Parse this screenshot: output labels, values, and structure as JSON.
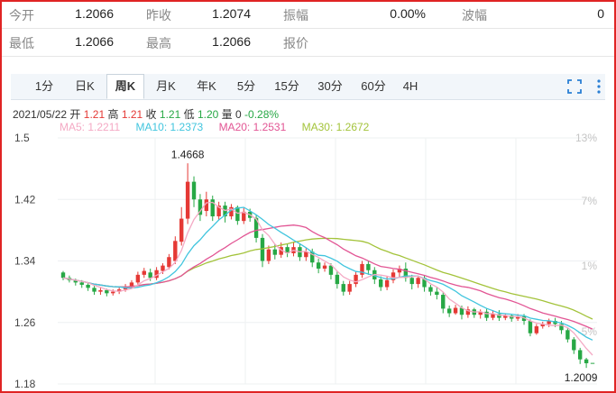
{
  "quote": {
    "row1": [
      {
        "label": "今开",
        "value": "1.2066"
      },
      {
        "label": "昨收",
        "value": "1.2074"
      },
      {
        "label": "振幅",
        "value": "0.00%"
      },
      {
        "label": "波幅",
        "value": "0"
      }
    ],
    "row2": [
      {
        "label": "最低",
        "value": "1.2066"
      },
      {
        "label": "最高",
        "value": "1.2066"
      },
      {
        "label": "报价",
        "value": ""
      }
    ]
  },
  "tabs": [
    {
      "label": "1分",
      "active": false
    },
    {
      "label": "日K",
      "active": false
    },
    {
      "label": "周K",
      "active": true
    },
    {
      "label": "月K",
      "active": false
    },
    {
      "label": "年K",
      "active": false
    },
    {
      "label": "5分",
      "active": false
    },
    {
      "label": "15分",
      "active": false
    },
    {
      "label": "30分",
      "active": false
    },
    {
      "label": "60分",
      "active": false
    },
    {
      "label": "4H",
      "active": false
    }
  ],
  "toolbar_icons": [
    "fullscreen-icon",
    "more-vertical-icon"
  ],
  "bar_info": {
    "date": "2021/05/22",
    "open_label": "开",
    "open": "1.21",
    "high_label": "高",
    "high": "1.21",
    "close_label": "收",
    "close": "1.21",
    "low_label": "低",
    "low": "1.20",
    "volume_label": "量",
    "volume": "0",
    "change": "-0.28%"
  },
  "ma_legend": [
    {
      "label": "MA5: 1.2211",
      "color": "#f4a9c4"
    },
    {
      "label": "MA10: 1.2373",
      "color": "#41c5de"
    },
    {
      "label": "MA20: 1.2531",
      "color": "#e25594"
    },
    {
      "label": "MA30: 1.2672",
      "color": "#a3c33a"
    }
  ],
  "colors": {
    "up": "#e53935",
    "down": "#27a845",
    "frame": "#e02424"
  },
  "chart_data": {
    "type": "candlestick",
    "y_ticks": [
      "1.5",
      "1.42",
      "1.34",
      "1.26",
      "1.18"
    ],
    "y_tick_values": [
      1.5,
      1.42,
      1.34,
      1.26,
      1.18
    ],
    "pct_ticks": [
      "13%",
      "7%",
      "1%",
      "-5%"
    ],
    "ylim": [
      1.18,
      1.5
    ],
    "annotations": {
      "max_label": "1.4668",
      "max_value": 1.4668,
      "min_label": "1.2009",
      "min_value": 1.2009
    },
    "candles": [
      [
        1.325,
        1.318,
        1.327,
        1.315
      ],
      [
        1.318,
        1.315,
        1.321,
        1.312
      ],
      [
        1.315,
        1.312,
        1.317,
        1.308
      ],
      [
        1.312,
        1.309,
        1.315,
        1.305
      ],
      [
        1.309,
        1.305,
        1.312,
        1.301
      ],
      [
        1.305,
        1.3,
        1.308,
        1.296
      ],
      [
        1.3,
        1.302,
        1.305,
        1.296
      ],
      [
        1.302,
        1.298,
        1.304,
        1.294
      ],
      [
        1.298,
        1.3,
        1.303,
        1.295
      ],
      [
        1.3,
        1.303,
        1.306,
        1.297
      ],
      [
        1.303,
        1.307,
        1.31,
        1.3
      ],
      [
        1.307,
        1.312,
        1.315,
        1.304
      ],
      [
        1.312,
        1.322,
        1.326,
        1.309
      ],
      [
        1.322,
        1.327,
        1.331,
        1.318
      ],
      [
        1.325,
        1.318,
        1.33,
        1.314
      ],
      [
        1.318,
        1.328,
        1.332,
        1.315
      ],
      [
        1.327,
        1.334,
        1.337,
        1.323
      ],
      [
        1.332,
        1.345,
        1.349,
        1.329
      ],
      [
        1.34,
        1.366,
        1.372,
        1.336
      ],
      [
        1.365,
        1.395,
        1.41,
        1.36
      ],
      [
        1.395,
        1.443,
        1.467,
        1.388
      ],
      [
        1.443,
        1.42,
        1.45,
        1.41
      ],
      [
        1.42,
        1.4,
        1.427,
        1.392
      ],
      [
        1.405,
        1.42,
        1.43,
        1.398
      ],
      [
        1.42,
        1.398,
        1.425,
        1.392
      ],
      [
        1.398,
        1.412,
        1.417,
        1.393
      ],
      [
        1.412,
        1.398,
        1.417,
        1.39
      ],
      [
        1.398,
        1.41,
        1.414,
        1.394
      ],
      [
        1.41,
        1.392,
        1.412,
        1.387
      ],
      [
        1.392,
        1.404,
        1.409,
        1.388
      ],
      [
        1.404,
        1.396,
        1.408,
        1.391
      ],
      [
        1.396,
        1.37,
        1.4,
        1.364
      ],
      [
        1.37,
        1.34,
        1.375,
        1.332
      ],
      [
        1.34,
        1.355,
        1.36,
        1.336
      ],
      [
        1.355,
        1.348,
        1.362,
        1.342
      ],
      [
        1.348,
        1.358,
        1.364,
        1.344
      ],
      [
        1.358,
        1.35,
        1.362,
        1.345
      ],
      [
        1.35,
        1.358,
        1.365,
        1.346
      ],
      [
        1.358,
        1.345,
        1.362,
        1.34
      ],
      [
        1.345,
        1.352,
        1.357,
        1.34
      ],
      [
        1.352,
        1.338,
        1.356,
        1.332
      ],
      [
        1.338,
        1.33,
        1.343,
        1.324
      ],
      [
        1.33,
        1.334,
        1.338,
        1.326
      ],
      [
        1.334,
        1.322,
        1.337,
        1.316
      ],
      [
        1.322,
        1.31,
        1.326,
        1.304
      ],
      [
        1.31,
        1.3,
        1.314,
        1.295
      ],
      [
        1.3,
        1.31,
        1.314,
        1.296
      ],
      [
        1.31,
        1.322,
        1.326,
        1.306
      ],
      [
        1.322,
        1.336,
        1.34,
        1.318
      ],
      [
        1.336,
        1.328,
        1.34,
        1.322
      ],
      [
        1.328,
        1.316,
        1.332,
        1.31
      ],
      [
        1.316,
        1.306,
        1.32,
        1.301
      ],
      [
        1.306,
        1.315,
        1.32,
        1.302
      ],
      [
        1.315,
        1.325,
        1.329,
        1.311
      ],
      [
        1.325,
        1.33,
        1.334,
        1.318
      ],
      [
        1.33,
        1.318,
        1.338,
        1.313
      ],
      [
        1.318,
        1.31,
        1.322,
        1.303
      ],
      [
        1.31,
        1.318,
        1.321,
        1.305
      ],
      [
        1.318,
        1.306,
        1.321,
        1.3
      ],
      [
        1.306,
        1.3,
        1.309,
        1.295
      ],
      [
        1.3,
        1.296,
        1.306,
        1.29
      ],
      [
        1.296,
        1.278,
        1.299,
        1.272
      ],
      [
        1.278,
        1.272,
        1.282,
        1.267
      ],
      [
        1.272,
        1.279,
        1.283,
        1.27
      ],
      [
        1.279,
        1.27,
        1.282,
        1.264
      ],
      [
        1.27,
        1.277,
        1.281,
        1.266
      ],
      [
        1.277,
        1.27,
        1.279,
        1.266
      ],
      [
        1.27,
        1.274,
        1.277,
        1.265
      ],
      [
        1.274,
        1.266,
        1.278,
        1.262
      ],
      [
        1.266,
        1.271,
        1.276,
        1.263
      ],
      [
        1.271,
        1.266,
        1.276,
        1.262
      ],
      [
        1.266,
        1.269,
        1.272,
        1.263
      ],
      [
        1.269,
        1.265,
        1.271,
        1.261
      ],
      [
        1.265,
        1.268,
        1.271,
        1.262
      ],
      [
        1.268,
        1.262,
        1.271,
        1.257
      ],
      [
        1.262,
        1.246,
        1.264,
        1.242
      ],
      [
        1.246,
        1.255,
        1.258,
        1.244
      ],
      [
        1.255,
        1.258,
        1.261,
        1.252
      ],
      [
        1.258,
        1.262,
        1.265,
        1.254
      ],
      [
        1.262,
        1.258,
        1.266,
        1.254
      ],
      [
        1.258,
        1.25,
        1.262,
        1.245
      ],
      [
        1.25,
        1.238,
        1.253,
        1.234
      ],
      [
        1.238,
        1.224,
        1.241,
        1.219
      ],
      [
        1.224,
        1.212,
        1.227,
        1.206
      ],
      [
        1.212,
        1.207,
        1.214,
        1.2009
      ],
      [
        1.2074,
        1.2066,
        1.2066,
        1.2066
      ]
    ]
  }
}
